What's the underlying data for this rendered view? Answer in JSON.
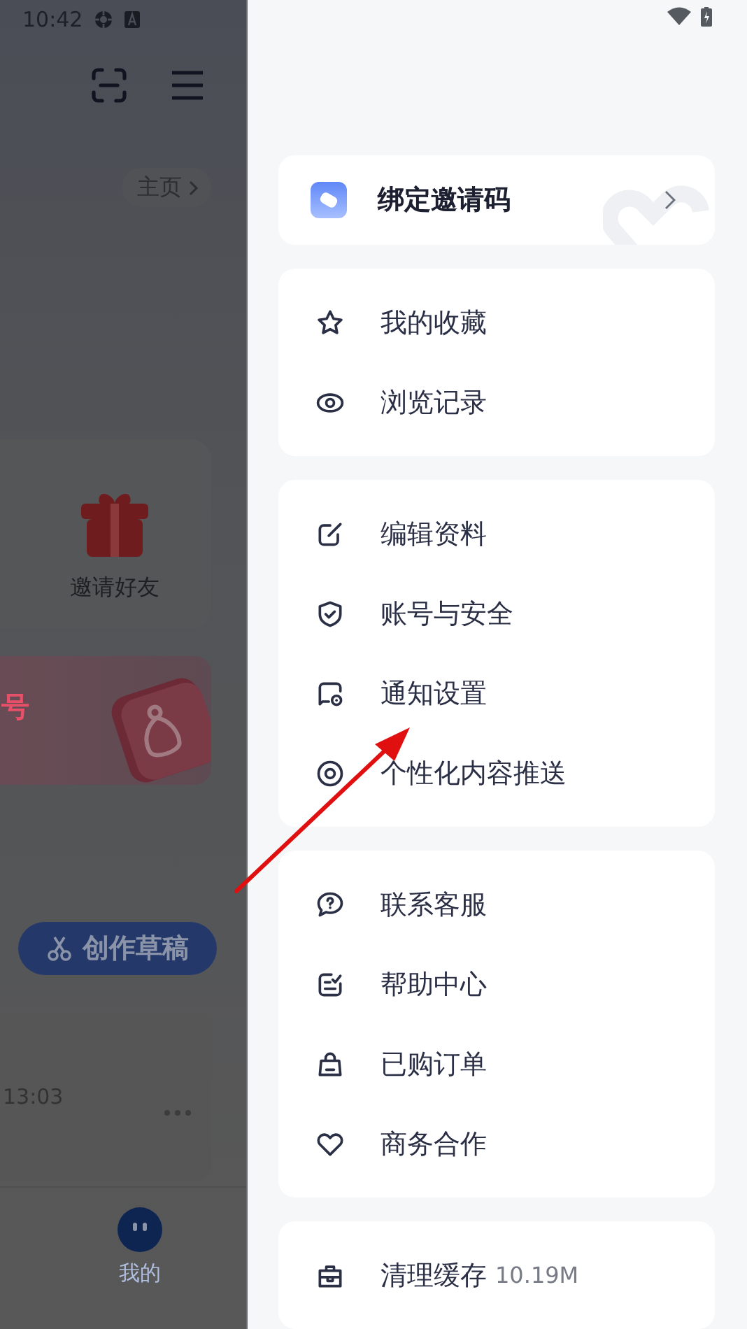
{
  "status_bar": {
    "time": "10:42"
  },
  "background_page": {
    "home_link": "主页",
    "shortcuts": [
      {
        "label": "邀请好友"
      }
    ],
    "banner": {
      "title": "号"
    },
    "draft_button": "创作草稿",
    "draft": {
      "time": "13:03"
    },
    "nav": [
      {
        "label": "我的",
        "selected": true
      }
    ]
  },
  "drawer": {
    "invite_card": {
      "title": "绑定邀请码"
    },
    "groups": [
      {
        "items": [
          {
            "label": "我的收藏"
          },
          {
            "label": "浏览记录"
          }
        ]
      },
      {
        "items": [
          {
            "label": "编辑资料"
          },
          {
            "label": "账号与安全"
          },
          {
            "label": "通知设置"
          },
          {
            "label": "个性化内容推送"
          }
        ]
      },
      {
        "items": [
          {
            "label": "联系客服"
          },
          {
            "label": "帮助中心"
          },
          {
            "label": "已购订单"
          },
          {
            "label": "商务合作"
          }
        ]
      },
      {
        "items": [
          {
            "label": "清理缓存",
            "value": "10.19M"
          }
        ]
      }
    ]
  }
}
